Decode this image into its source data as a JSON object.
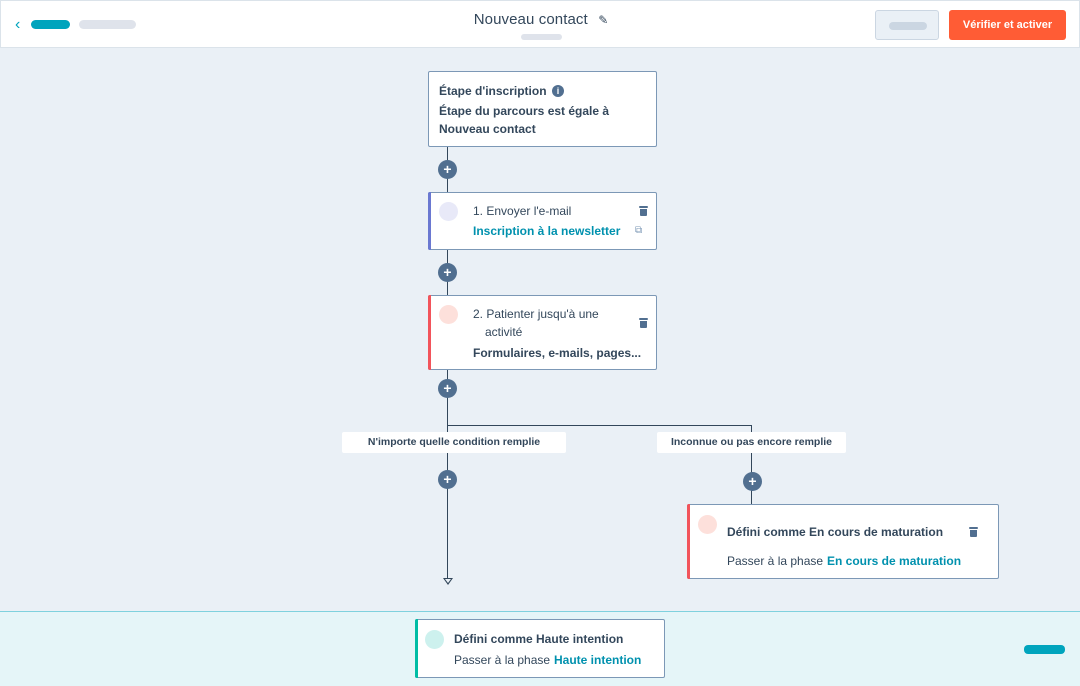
{
  "topbar": {
    "title": "Nouveau contact",
    "primary_button": "Vérifier et activer"
  },
  "trigger": {
    "heading": "Étape d'inscription",
    "line1": "Étape du parcours est égale à",
    "line2": "Nouveau contact"
  },
  "steps": [
    {
      "label": "1. Envoyer l'e-mail",
      "link": "Inscription à la newsletter",
      "accent": "#6a78d1",
      "avatar_color": "#e8e9f8"
    },
    {
      "label_line1": "2. Patienter jusqu'à une",
      "label_line2": "activité",
      "detail": "Formulaires, e-mails, pages...",
      "accent": "#f2545b",
      "avatar_color": "#fde0db"
    }
  ],
  "branches": {
    "left": "N'importe quelle condition remplie",
    "right": "Inconnue ou pas encore remplie"
  },
  "branch_action": {
    "title": "Défini comme En cours de maturation",
    "prefix": "Passer à la phase",
    "link": "En cours de maturation",
    "accent": "#f2545b",
    "avatar_color": "#fde0db"
  },
  "goal": {
    "title": "Défini comme Haute intention",
    "prefix": "Passer à la phase",
    "link": "Haute intention",
    "accent": "#00bda5",
    "avatar_color": "#cdf1ee"
  },
  "icons": {
    "add": "+",
    "info": "i",
    "external": "⧉",
    "pencil": "✎",
    "back": "‹"
  }
}
